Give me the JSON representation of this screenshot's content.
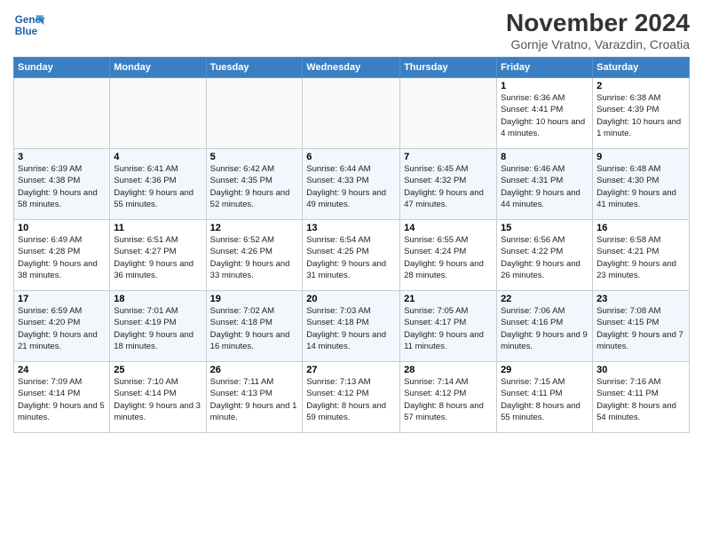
{
  "header": {
    "logo_line1": "General",
    "logo_line2": "Blue",
    "month": "November 2024",
    "location": "Gornje Vratno, Varazdin, Croatia"
  },
  "weekdays": [
    "Sunday",
    "Monday",
    "Tuesday",
    "Wednesday",
    "Thursday",
    "Friday",
    "Saturday"
  ],
  "weeks": [
    [
      {
        "day": "",
        "info": ""
      },
      {
        "day": "",
        "info": ""
      },
      {
        "day": "",
        "info": ""
      },
      {
        "day": "",
        "info": ""
      },
      {
        "day": "",
        "info": ""
      },
      {
        "day": "1",
        "info": "Sunrise: 6:36 AM\nSunset: 4:41 PM\nDaylight: 10 hours\nand 4 minutes."
      },
      {
        "day": "2",
        "info": "Sunrise: 6:38 AM\nSunset: 4:39 PM\nDaylight: 10 hours\nand 1 minute."
      }
    ],
    [
      {
        "day": "3",
        "info": "Sunrise: 6:39 AM\nSunset: 4:38 PM\nDaylight: 9 hours\nand 58 minutes."
      },
      {
        "day": "4",
        "info": "Sunrise: 6:41 AM\nSunset: 4:36 PM\nDaylight: 9 hours\nand 55 minutes."
      },
      {
        "day": "5",
        "info": "Sunrise: 6:42 AM\nSunset: 4:35 PM\nDaylight: 9 hours\nand 52 minutes."
      },
      {
        "day": "6",
        "info": "Sunrise: 6:44 AM\nSunset: 4:33 PM\nDaylight: 9 hours\nand 49 minutes."
      },
      {
        "day": "7",
        "info": "Sunrise: 6:45 AM\nSunset: 4:32 PM\nDaylight: 9 hours\nand 47 minutes."
      },
      {
        "day": "8",
        "info": "Sunrise: 6:46 AM\nSunset: 4:31 PM\nDaylight: 9 hours\nand 44 minutes."
      },
      {
        "day": "9",
        "info": "Sunrise: 6:48 AM\nSunset: 4:30 PM\nDaylight: 9 hours\nand 41 minutes."
      }
    ],
    [
      {
        "day": "10",
        "info": "Sunrise: 6:49 AM\nSunset: 4:28 PM\nDaylight: 9 hours\nand 38 minutes."
      },
      {
        "day": "11",
        "info": "Sunrise: 6:51 AM\nSunset: 4:27 PM\nDaylight: 9 hours\nand 36 minutes."
      },
      {
        "day": "12",
        "info": "Sunrise: 6:52 AM\nSunset: 4:26 PM\nDaylight: 9 hours\nand 33 minutes."
      },
      {
        "day": "13",
        "info": "Sunrise: 6:54 AM\nSunset: 4:25 PM\nDaylight: 9 hours\nand 31 minutes."
      },
      {
        "day": "14",
        "info": "Sunrise: 6:55 AM\nSunset: 4:24 PM\nDaylight: 9 hours\nand 28 minutes."
      },
      {
        "day": "15",
        "info": "Sunrise: 6:56 AM\nSunset: 4:22 PM\nDaylight: 9 hours\nand 26 minutes."
      },
      {
        "day": "16",
        "info": "Sunrise: 6:58 AM\nSunset: 4:21 PM\nDaylight: 9 hours\nand 23 minutes."
      }
    ],
    [
      {
        "day": "17",
        "info": "Sunrise: 6:59 AM\nSunset: 4:20 PM\nDaylight: 9 hours\nand 21 minutes."
      },
      {
        "day": "18",
        "info": "Sunrise: 7:01 AM\nSunset: 4:19 PM\nDaylight: 9 hours\nand 18 minutes."
      },
      {
        "day": "19",
        "info": "Sunrise: 7:02 AM\nSunset: 4:18 PM\nDaylight: 9 hours\nand 16 minutes."
      },
      {
        "day": "20",
        "info": "Sunrise: 7:03 AM\nSunset: 4:18 PM\nDaylight: 9 hours\nand 14 minutes."
      },
      {
        "day": "21",
        "info": "Sunrise: 7:05 AM\nSunset: 4:17 PM\nDaylight: 9 hours\nand 11 minutes."
      },
      {
        "day": "22",
        "info": "Sunrise: 7:06 AM\nSunset: 4:16 PM\nDaylight: 9 hours\nand 9 minutes."
      },
      {
        "day": "23",
        "info": "Sunrise: 7:08 AM\nSunset: 4:15 PM\nDaylight: 9 hours\nand 7 minutes."
      }
    ],
    [
      {
        "day": "24",
        "info": "Sunrise: 7:09 AM\nSunset: 4:14 PM\nDaylight: 9 hours\nand 5 minutes."
      },
      {
        "day": "25",
        "info": "Sunrise: 7:10 AM\nSunset: 4:14 PM\nDaylight: 9 hours\nand 3 minutes."
      },
      {
        "day": "26",
        "info": "Sunrise: 7:11 AM\nSunset: 4:13 PM\nDaylight: 9 hours\nand 1 minute."
      },
      {
        "day": "27",
        "info": "Sunrise: 7:13 AM\nSunset: 4:12 PM\nDaylight: 8 hours\nand 59 minutes."
      },
      {
        "day": "28",
        "info": "Sunrise: 7:14 AM\nSunset: 4:12 PM\nDaylight: 8 hours\nand 57 minutes."
      },
      {
        "day": "29",
        "info": "Sunrise: 7:15 AM\nSunset: 4:11 PM\nDaylight: 8 hours\nand 55 minutes."
      },
      {
        "day": "30",
        "info": "Sunrise: 7:16 AM\nSunset: 4:11 PM\nDaylight: 8 hours\nand 54 minutes."
      }
    ]
  ]
}
